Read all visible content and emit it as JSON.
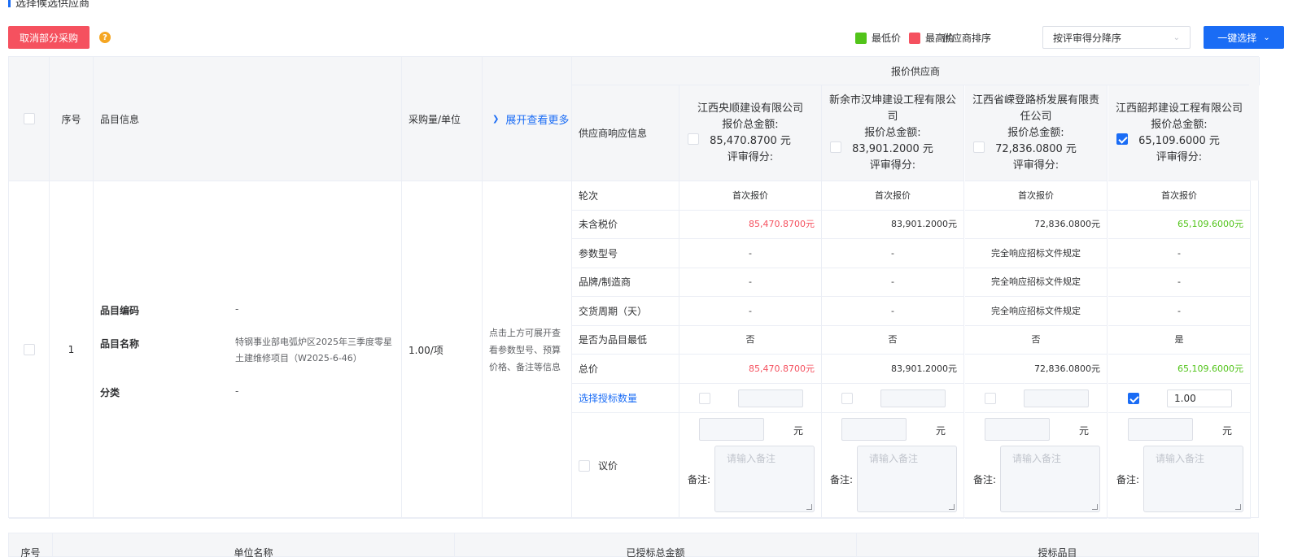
{
  "section_title": "选择候选供应商",
  "toolbar": {
    "cancel_label": "取消部分采购",
    "help_icon": "?",
    "legend_low": "最低价",
    "legend_high": "最高价",
    "legend_low_color": "#52c41a",
    "legend_high_color": "#f5515f",
    "sort_label": "供应商排序",
    "sort_value": "按评审得分降序",
    "one_click_label": "一键选择"
  },
  "table": {
    "head": {
      "seq": "序号",
      "item_info": "品目信息",
      "qty_unit": "采购量/单位",
      "expand": "展开查看更多",
      "quote_supplier": "报价供应商",
      "response_info": "供应商响应信息"
    },
    "suppliers": [
      {
        "name": "江西央顺建设有限公司",
        "total_label": "报价总金额:",
        "total": "85,470.8700 元",
        "score_label": "评审得分:",
        "checked": false
      },
      {
        "name": "新余市汉坤建设工程有限公司",
        "total_label": "报价总金额:",
        "total": "83,901.2000 元",
        "score_label": "评审得分:",
        "checked": false
      },
      {
        "name": "江西省嵘登路桥发展有限责任公司",
        "total_label": "报价总金额:",
        "total": "72,836.0800 元",
        "score_label": "评审得分:",
        "checked": false
      },
      {
        "name": "江西韶邦建设工程有限公司",
        "total_label": "报价总金额:",
        "total": "65,109.6000 元",
        "score_label": "评审得分:",
        "checked": true
      }
    ],
    "row": {
      "seq": "1",
      "code_label": "品目编码",
      "code_value": "-",
      "name_label": "品目名称",
      "name_value": "特钢事业部电弧炉区2025年三季度零星土建维修项目（W2025-6-46）",
      "category_label": "分类",
      "category_value": "-",
      "qty": "1.00/项",
      "expand_hint": "点击上方可展开查看参数型号、预算价格、备注等信息"
    },
    "resp_rows": [
      {
        "label": "轮次",
        "values": [
          "首次报价",
          "首次报价",
          "首次报价",
          "首次报价"
        ]
      },
      {
        "label": "未含税价",
        "values": [
          "85,470.8700元",
          "83,901.2000元",
          "72,836.0800元",
          "65,109.6000元"
        ]
      },
      {
        "label": "参数型号",
        "values": [
          "-",
          "-",
          "完全响应招标文件规定",
          "-"
        ]
      },
      {
        "label": "品牌/制造商",
        "values": [
          "-",
          "-",
          "完全响应招标文件规定",
          "-"
        ]
      },
      {
        "label": "交货周期（天）",
        "values": [
          "-",
          "-",
          "完全响应招标文件规定",
          "-"
        ]
      },
      {
        "label": "是否为品目最低",
        "values": [
          "否",
          "否",
          "否",
          "是"
        ]
      },
      {
        "label": "总价",
        "values": [
          "85,470.8700元",
          "83,901.2000元",
          "72,836.0800元",
          "65,109.6000元"
        ]
      }
    ],
    "select_qty_label": "选择授标数量",
    "select_qty_values": [
      "",
      "",
      "",
      "1.00"
    ],
    "negotiate_label": "议价",
    "yuan": "元",
    "remark_label": "备注:",
    "remark_placeholder": "请输入备注"
  },
  "bottom_head": {
    "col1": "序号",
    "col2": "单位名称",
    "col3": "已授标总金额",
    "col4": "授标品目"
  }
}
